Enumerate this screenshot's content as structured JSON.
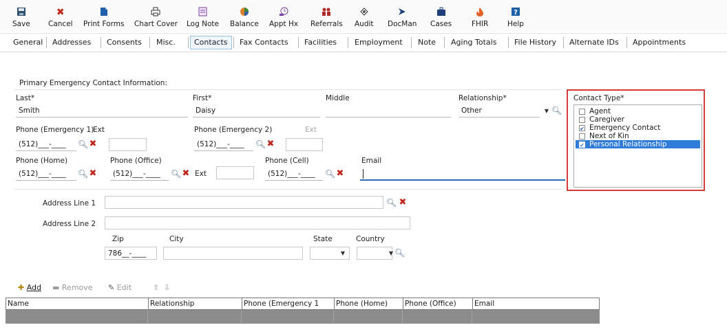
{
  "toolbar": {
    "items": [
      {
        "label": "Save",
        "icon": "save-icon",
        "color": "#2f4f6f"
      },
      {
        "label": "Cancel",
        "icon": "cancel-icon",
        "color": "#c0271c"
      },
      {
        "label": "Print Forms",
        "icon": "document-icon",
        "color": "#1d5fa8"
      },
      {
        "label": "Chart Cover",
        "icon": "printer-icon",
        "color": "#333333"
      },
      {
        "label": "Log Note",
        "icon": "note-icon",
        "color": "#7a3fa0"
      },
      {
        "label": "Balance",
        "icon": "pie-chart-icon",
        "color": "#d9822b"
      },
      {
        "label": "Appt Hx",
        "icon": "appointment-icon",
        "color": "#7a3fa0"
      },
      {
        "label": "Referrals",
        "icon": "people-icon",
        "color": "#b02a2a"
      },
      {
        "label": "Audit",
        "icon": "audit-icon",
        "color": "#333333"
      },
      {
        "label": "DocMan",
        "icon": "arrow-icon",
        "color": "#1d3f7a"
      },
      {
        "label": "Cases",
        "icon": "briefcase-icon",
        "color": "#1d3f7a"
      },
      {
        "label": "FHIR",
        "icon": "flame-icon",
        "color": "#e5612a"
      },
      {
        "label": "Help",
        "icon": "help-icon",
        "color": "#1d5fa8"
      }
    ]
  },
  "tabs": [
    "General",
    "Addresses",
    "Consents",
    "Misc.",
    "Contacts",
    "Fax Contacts",
    "Facilities",
    "Employment",
    "Note",
    "Aging Totals",
    "File History",
    "Alternate IDs",
    "Appointments"
  ],
  "active_tab": "Contacts",
  "section_title": "Primary Emergency Contact Information:",
  "form": {
    "last_label": "Last*",
    "last_value": "Smith",
    "first_label": "First*",
    "first_value": "Daisy",
    "middle_label": "Middle",
    "middle_value": "",
    "relationship_label": "Relationship*",
    "relationship_value": "Other",
    "phone_em1_label": "Phone (Emergency 1)",
    "phone_em1_value": "(512)___-____",
    "ext1_label": "Ext",
    "ext1_value": "",
    "phone_em2_label": "Phone (Emergency 2)",
    "phone_em2_value": "(512)___-____",
    "ext2_label": "Ext",
    "ext2_value": "",
    "phone_home_label": "Phone (Home)",
    "phone_home_value": "(512)___-____",
    "phone_office_label": "Phone (Office)",
    "phone_office_value": "(512)___-____",
    "ext3_label": "Ext",
    "ext3_value": "",
    "phone_cell_label": "Phone (Cell)",
    "phone_cell_value": "(512)___-____",
    "email_label": "Email",
    "email_value": ""
  },
  "contact_type": {
    "label": "Contact Type*",
    "items": [
      {
        "label": "Agent",
        "checked": false
      },
      {
        "label": "Caregiver",
        "checked": false
      },
      {
        "label": "Emergency Contact",
        "checked": true
      },
      {
        "label": "Next of Kin",
        "checked": false
      },
      {
        "label": "Personal Relationship",
        "checked": true,
        "selected": true
      }
    ]
  },
  "address": {
    "line1_label": "Address Line 1",
    "line1_value": "",
    "line2_label": "Address Line 2",
    "line2_value": "",
    "zip_label": "Zip",
    "zip_value": "786__-____",
    "city_label": "City",
    "city_value": "",
    "state_label": "State",
    "state_value": "",
    "country_label": "Country",
    "country_value": ""
  },
  "actions": {
    "add": "Add",
    "remove": "Remove",
    "edit": "Edit"
  },
  "grid": {
    "columns": [
      "Name",
      "Relationship",
      "Phone (Emergency 1",
      "Phone (Home)",
      "Phone (Office)",
      "Email"
    ]
  }
}
